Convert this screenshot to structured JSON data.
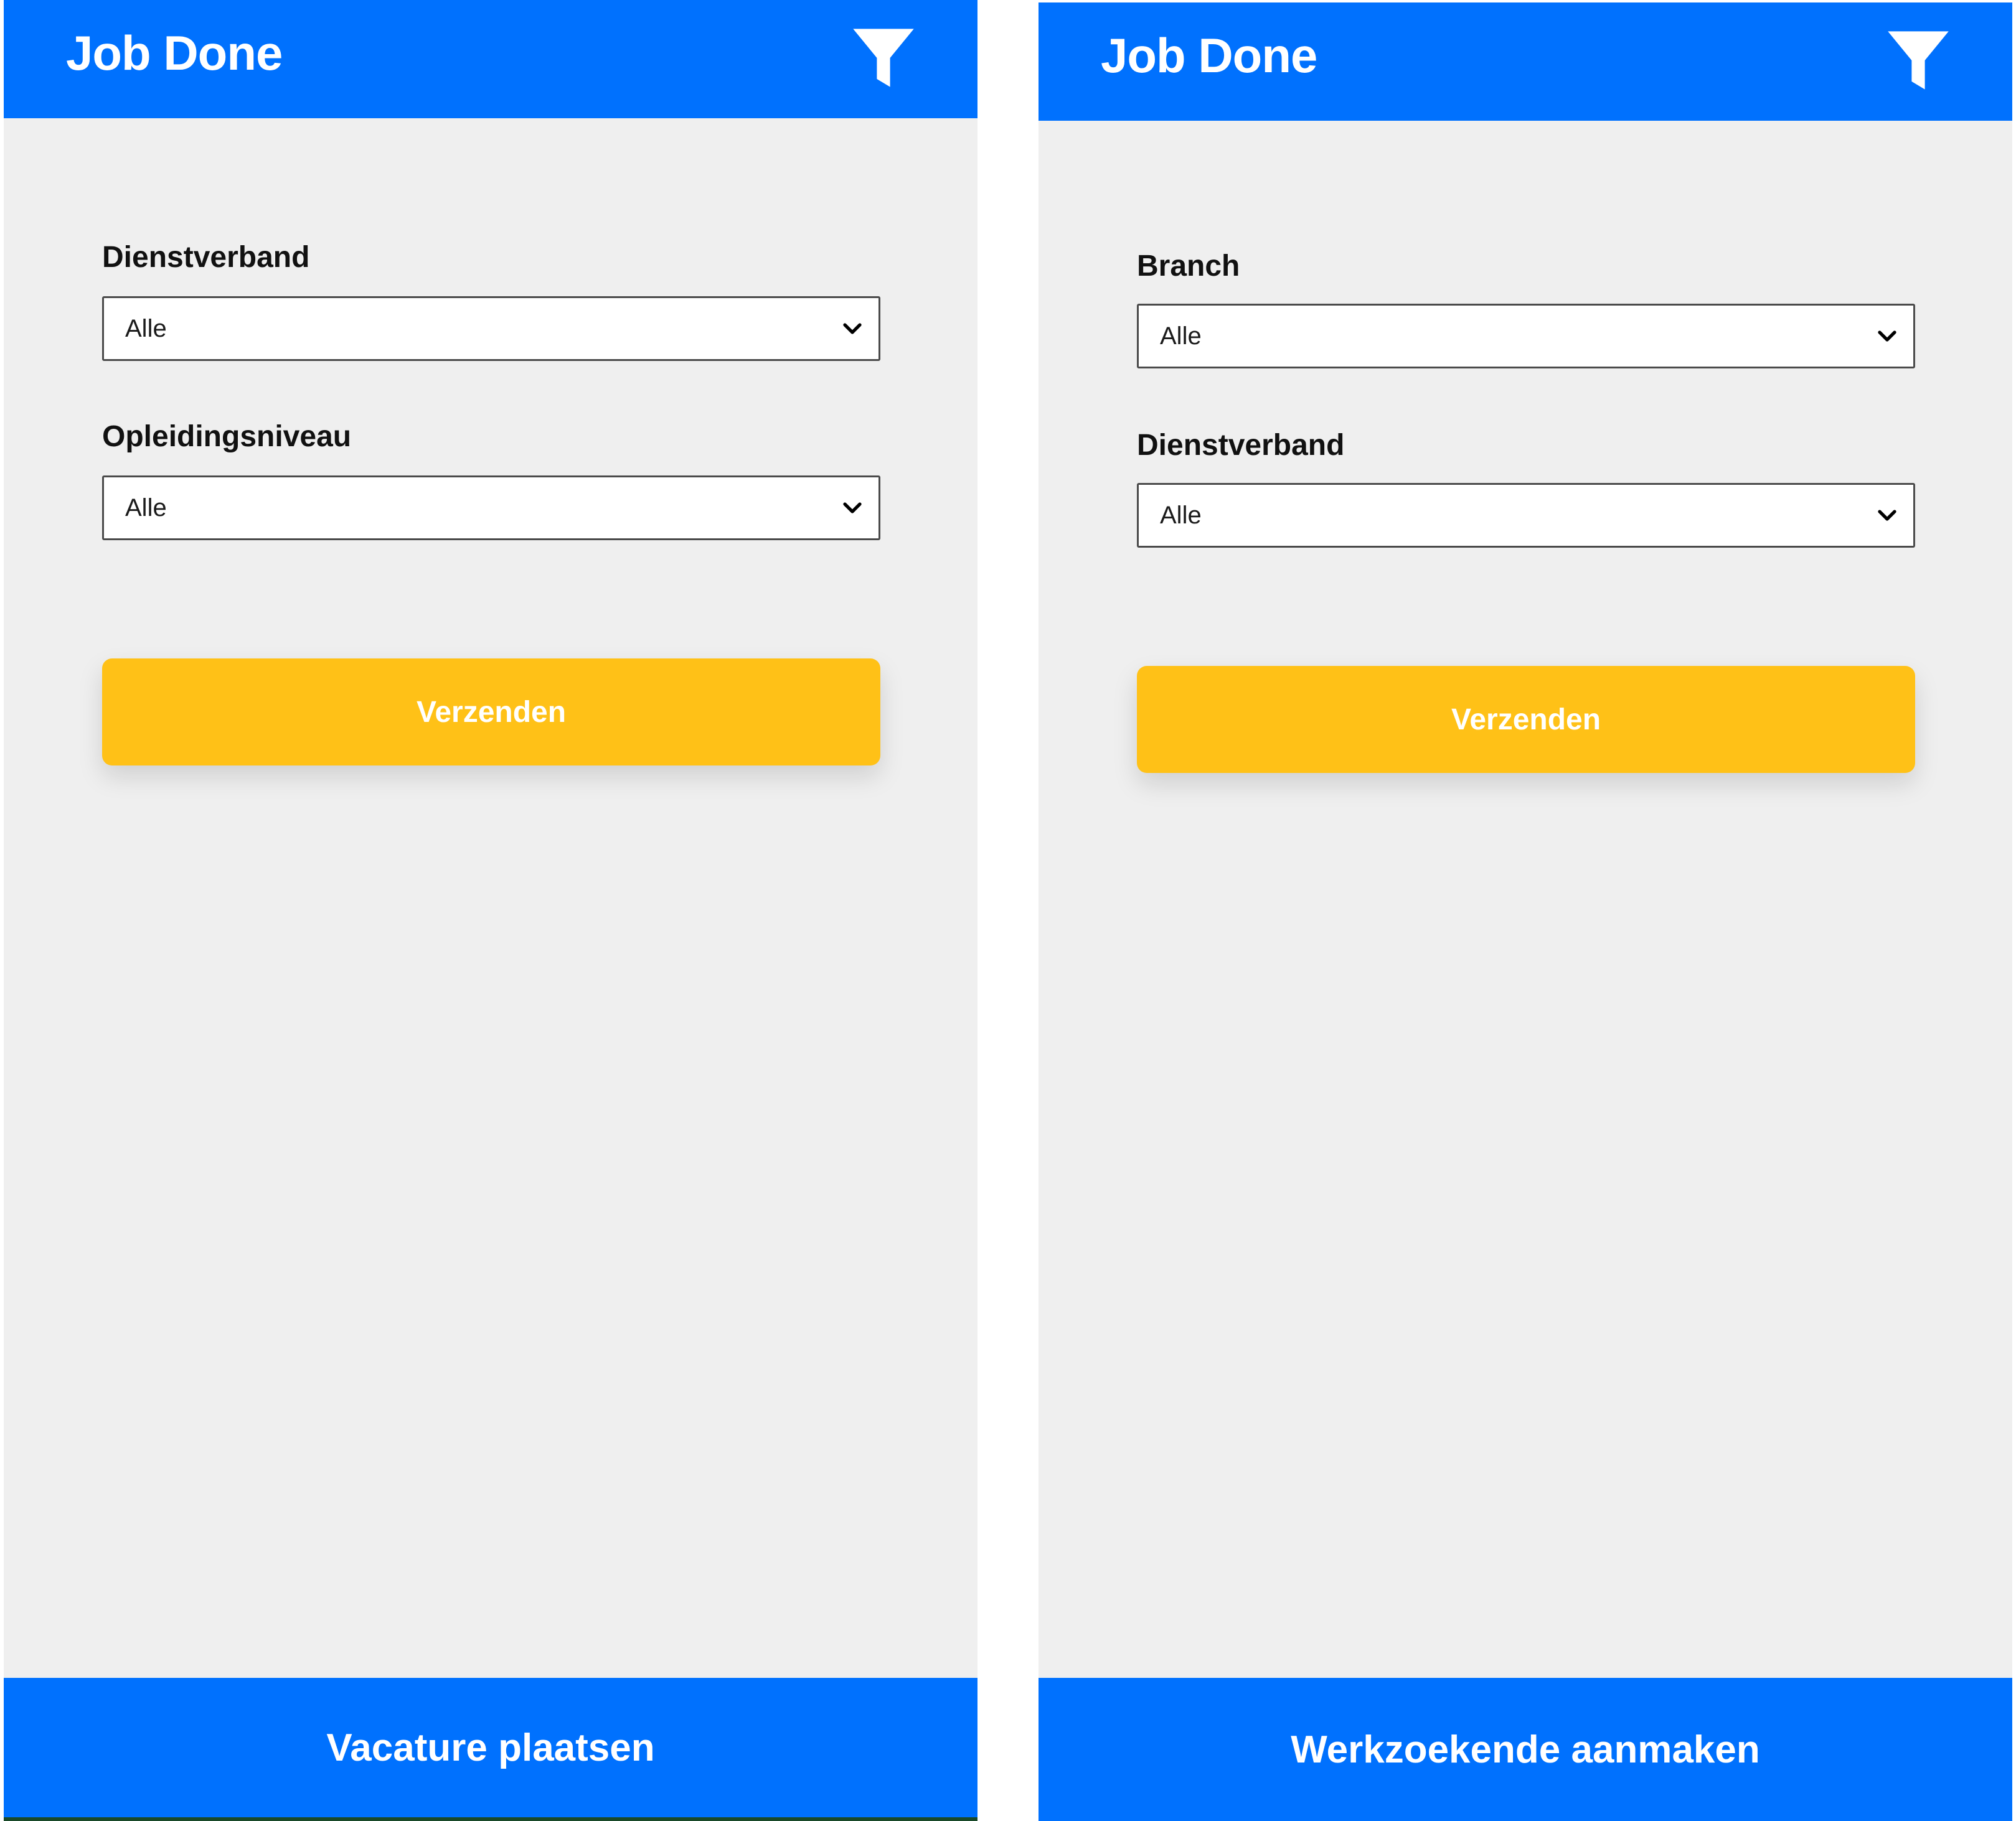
{
  "left_screen": {
    "app_title": "Job Done",
    "filter_icon": "filter-funnel-icon",
    "fields": [
      {
        "label": "Dienstverband",
        "value": "Alle"
      },
      {
        "label": "Opleidingsniveau",
        "value": "Alle"
      }
    ],
    "submit_label": "Verzenden",
    "bottom_action": "Vacature plaatsen"
  },
  "right_screen": {
    "app_title": "Job Done",
    "filter_icon": "filter-funnel-icon",
    "fields": [
      {
        "label": "Branch",
        "value": "Alle"
      },
      {
        "label": "Dienstverband",
        "value": "Alle"
      }
    ],
    "submit_label": "Verzenden",
    "bottom_action": "Werkzoekende aanmaken"
  },
  "colors": {
    "primary_blue": "#0071fe",
    "accent_yellow": "#ffc117",
    "background": "#efefef"
  }
}
